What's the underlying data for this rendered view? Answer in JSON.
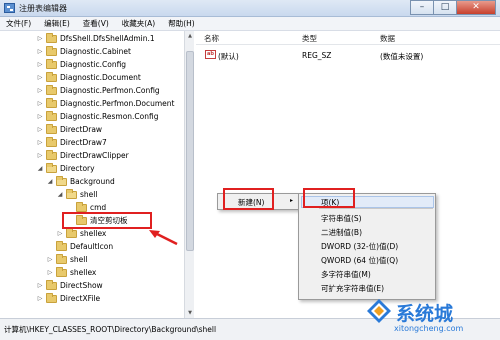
{
  "window": {
    "title": "注册表编辑器",
    "buttons": {
      "minimize": "–",
      "maximize": "□",
      "close": "✕"
    }
  },
  "menubar": [
    "文件(F)",
    "编辑(E)",
    "查看(V)",
    "收藏夹(A)",
    "帮助(H)"
  ],
  "tree": [
    {
      "label": "DfsShell.DfsShellAdmin.1",
      "expander": "▷"
    },
    {
      "label": "Diagnostic.Cabinet",
      "expander": "▷"
    },
    {
      "label": "Diagnostic.Config",
      "expander": "▷"
    },
    {
      "label": "Diagnostic.Document",
      "expander": "▷"
    },
    {
      "label": "Diagnostic.Perfmon.Config",
      "expander": "▷"
    },
    {
      "label": "Diagnostic.Perfmon.Document",
      "expander": "▷"
    },
    {
      "label": "Diagnostic.Resmon.Config",
      "expander": "▷"
    },
    {
      "label": "DirectDraw",
      "expander": "▷"
    },
    {
      "label": "DirectDraw7",
      "expander": "▷"
    },
    {
      "label": "DirectDrawClipper",
      "expander": "▷"
    },
    {
      "label": "Directory",
      "expander": "◢"
    },
    {
      "label": "Background",
      "expander": "◢"
    },
    {
      "label": "shell",
      "expander": "◢"
    },
    {
      "label": "cmd",
      "expander": ""
    },
    {
      "label": "清空剪切板",
      "expander": ""
    },
    {
      "label": "shellex",
      "expander": "▷"
    },
    {
      "label": "DefaultIcon",
      "expander": ""
    },
    {
      "label": "shell",
      "expander": "▷"
    },
    {
      "label": "shellex",
      "expander": "▷"
    },
    {
      "label": "DirectShow",
      "expander": "▷"
    },
    {
      "label": "DirectXFile",
      "expander": "▷"
    }
  ],
  "columns": {
    "name": "名称",
    "type": "类型",
    "data": "数据"
  },
  "values": [
    {
      "icon": "ab",
      "name": "(默认)",
      "type": "REG_SZ",
      "data": "(数值未设置)"
    }
  ],
  "context_menu": {
    "new_label": "新建(N)",
    "arrow": "▸",
    "submenu": [
      "项(K)",
      "字符串值(S)",
      "二进制值(B)",
      "DWORD (32-位)值(D)",
      "QWORD (64 位)值(Q)",
      "多字符串值(M)",
      "可扩充字符串值(E)"
    ]
  },
  "status_path": "计算机\\HKEY_CLASSES_ROOT\\Directory\\Background\\shell",
  "watermark": {
    "text_cn": "系统城",
    "text_url": "xitongcheng.com"
  },
  "colors": {
    "annotation_red": "#e02020",
    "watermark_blue": "#2a7ad8"
  }
}
